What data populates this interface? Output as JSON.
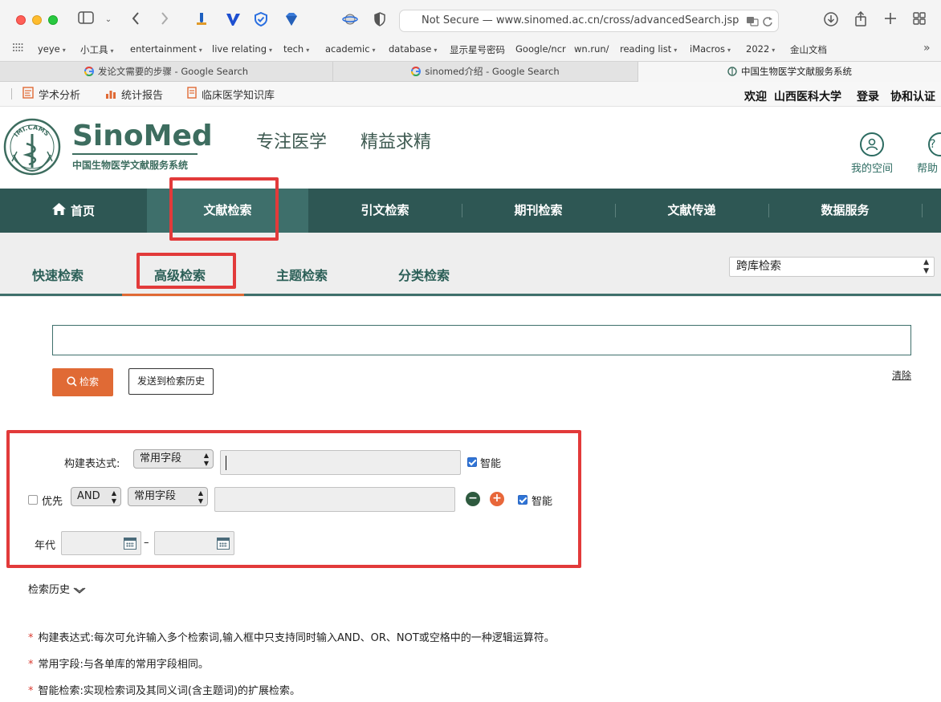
{
  "browser": {
    "address": "Not Secure — www.sinomed.ac.cn/cross/advancedSearch.jsp",
    "bookmarks": [
      {
        "label": "yeye",
        "chevron": true
      },
      {
        "label": "小工具",
        "chevron": true
      },
      {
        "label": "entertainment",
        "chevron": true
      },
      {
        "label": "live relating",
        "chevron": true
      },
      {
        "label": "tech",
        "chevron": true
      },
      {
        "label": "academic",
        "chevron": true
      },
      {
        "label": "database",
        "chevron": true
      },
      {
        "label": "显示星号密码",
        "chevron": false
      },
      {
        "label": "Google/ncr",
        "chevron": false
      },
      {
        "label": "wn.run/",
        "chevron": false
      },
      {
        "label": "reading list",
        "chevron": true
      },
      {
        "label": "iMacros",
        "chevron": true
      },
      {
        "label": "2022",
        "chevron": true
      },
      {
        "label": "金山文档",
        "chevron": false
      }
    ],
    "tabs": [
      {
        "label": "发论文需要的步骤 - Google Search",
        "favicon": "google-icon"
      },
      {
        "label": "sinomed介绍 - Google Search",
        "favicon": "google-icon"
      },
      {
        "label": "中国生物医学文献服务系统",
        "favicon": "sinomed-favicon"
      }
    ]
  },
  "sitebar": {
    "links": [
      "学术分析",
      "统计报告",
      "临床医学知识库"
    ],
    "welcome": "欢迎",
    "institution": "山西医科大学",
    "login": "登录",
    "auth": "协和认证"
  },
  "header": {
    "logo": "SinoMed",
    "logo_sub": "中国生物医学文献服务系统",
    "emblem_text": "IMI.CAMS",
    "slogan1": "专注医学",
    "slogan2": "精益求精",
    "my_space": "我的空间",
    "help": "帮助"
  },
  "nav": {
    "items": [
      "首页",
      "文献检索",
      "引文检索",
      "期刊检索",
      "文献传递",
      "数据服务"
    ],
    "active": "文献检索"
  },
  "subtabs": {
    "items": [
      "快速检索",
      "高级检索",
      "主题检索",
      "分类检索"
    ],
    "active": "高级检索",
    "db_select": "跨库检索"
  },
  "search": {
    "query": "",
    "search_button": "检索",
    "send_history": "发送到检索历史",
    "clear": "清除"
  },
  "builder": {
    "expr_label": "构建表达式:",
    "field1": "常用字段",
    "smart1_checked": true,
    "smart_label": "智能",
    "priority_label": "优先",
    "priority_checked": false,
    "operator": "AND",
    "field2": "常用字段",
    "smart2_checked": true,
    "year_label": "年代",
    "year_sep": "–"
  },
  "history": {
    "label": "检索历史"
  },
  "notes": [
    "构建表达式:每次可允许输入多个检索词,输入框中只支持同时输入AND、OR、NOT或空格中的一种逻辑运算符。",
    "常用字段:与各单库的常用字段相同。",
    "智能检索:实现检索词及其同义词(含主题词)的扩展检索。"
  ],
  "colors": {
    "nav_bg": "#2e5754",
    "nav_active": "#3e6f6b",
    "accent_orange": "#e06a35",
    "annotation_red": "#e23a3a",
    "brand_green": "#3d6d5f"
  }
}
